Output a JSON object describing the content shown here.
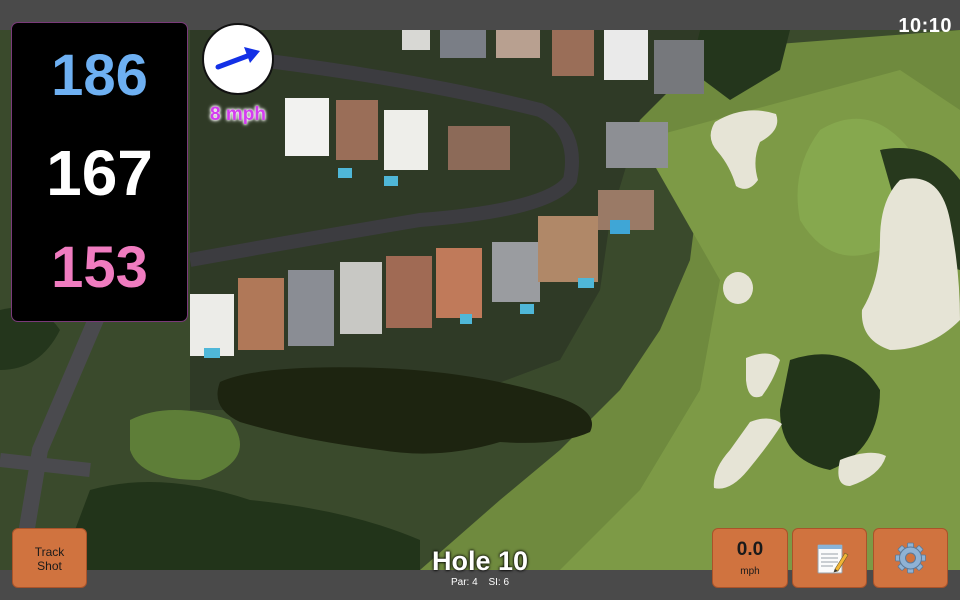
{
  "status_bar": {
    "time": "10:10"
  },
  "yardages": {
    "back": "186",
    "middle": "167",
    "front": "153"
  },
  "wind": {
    "speed_label": "8 mph",
    "icon": "wind-arrow-icon"
  },
  "hole": {
    "title": "Hole 10",
    "par": "Par: 4",
    "stroke_index": "SI: 6"
  },
  "buttons": {
    "track_shot": {
      "line1": "Track",
      "line2": "Shot"
    },
    "speed": {
      "value": "0.0",
      "unit": "mph"
    },
    "notes": {
      "icon": "notepad-icon"
    },
    "settings": {
      "icon": "gear-icon"
    }
  },
  "colors": {
    "back": "#6eb0f2",
    "middle": "#ffffff",
    "front": "#f07cc0",
    "button": "#d0733f",
    "wind_text": "#d43cf0",
    "wind_arrow": "#1330e6"
  }
}
